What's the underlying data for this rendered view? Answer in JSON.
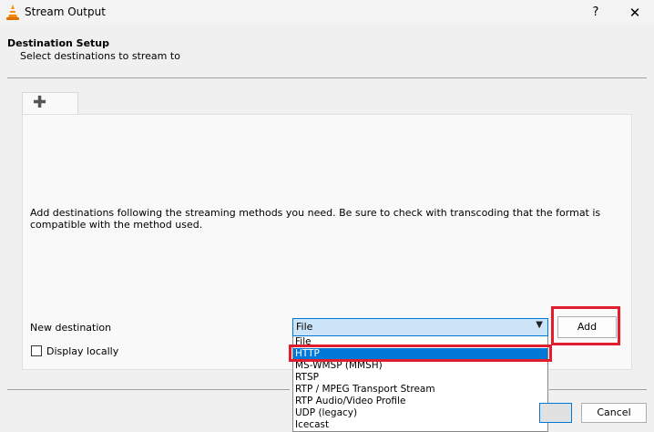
{
  "window": {
    "title": "Stream Output",
    "help_label": "?",
    "close_label": "✕"
  },
  "header": {
    "title": "Destination Setup",
    "subtitle": "Select destinations to stream to"
  },
  "tab": {
    "plus_label": "✚"
  },
  "panel": {
    "info_text": "Add destinations following the streaming methods you need. Be sure to check with transcoding that the format is compatible with the method used."
  },
  "new_destination": {
    "label": "New destination",
    "selected": "File",
    "options": [
      "File",
      "HTTP",
      "MS-WMSP (MMSH)",
      "RTSP",
      "RTP / MPEG Transport Stream",
      "RTP Audio/Video Profile",
      "UDP (legacy)",
      "Icecast"
    ],
    "add_label": "Add"
  },
  "display_locally": {
    "label": "Display locally",
    "checked": false
  },
  "footer": {
    "cancel_label": "Cancel"
  },
  "colors": {
    "highlight": "#e21d2d",
    "selection": "#0078d7",
    "combo_bg": "#cce4f7"
  }
}
